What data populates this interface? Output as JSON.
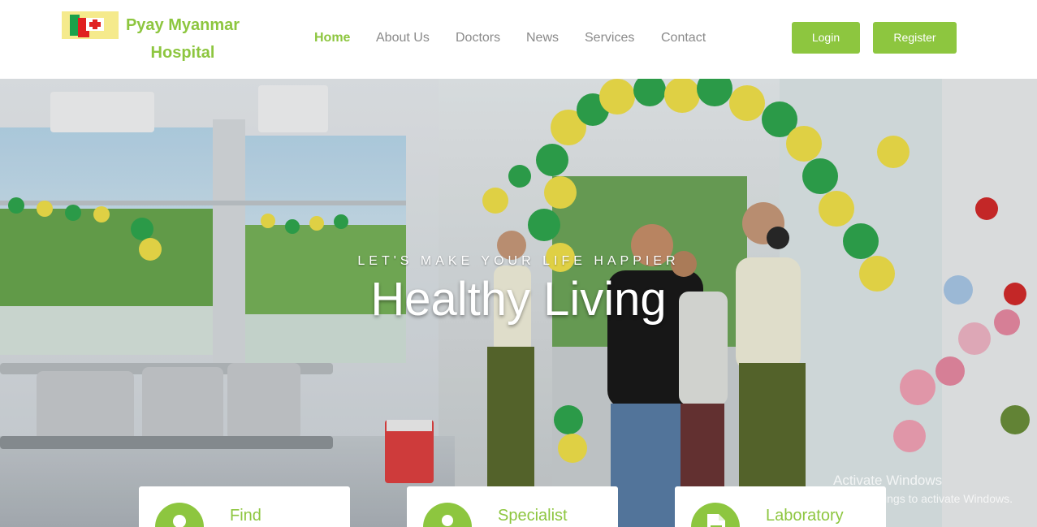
{
  "brand": {
    "name_line1": "Pyay Myanmar",
    "name_line2": "Hospital"
  },
  "nav": {
    "items": [
      {
        "label": "Home",
        "active": true
      },
      {
        "label": "About Us",
        "active": false
      },
      {
        "label": "Doctors",
        "active": false
      },
      {
        "label": "News",
        "active": false
      },
      {
        "label": "Services",
        "active": false
      },
      {
        "label": "Contact",
        "active": false
      }
    ]
  },
  "auth": {
    "login_label": "Login",
    "register_label": "Register"
  },
  "hero": {
    "tagline": "LET'S MAKE YOUR LIFE HAPPIER",
    "headline": "Healthy Living"
  },
  "features": [
    {
      "title": "Find",
      "icon": "person-icon"
    },
    {
      "title": "Specialist",
      "icon": "doctor-icon"
    },
    {
      "title": "Laboratory",
      "icon": "document-icon"
    }
  ],
  "watermark": {
    "line1": "Activate Windows",
    "line2": "Go to Settings to activate Windows."
  },
  "colors": {
    "accent": "#8dc63f",
    "nav_text": "#8a8a8a",
    "white": "#ffffff"
  }
}
